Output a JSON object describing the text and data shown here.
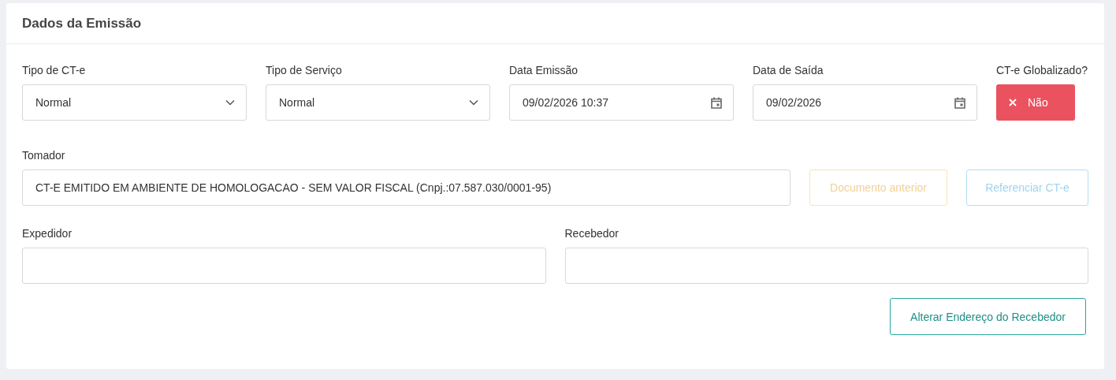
{
  "card": {
    "title": "Dados da Emissão"
  },
  "row_1": [
    {
      "kind": "select",
      "label": "Tipo de CT-e",
      "value": "Normal"
    },
    {
      "kind": "select",
      "label": "Tipo de Serviço",
      "value": "Normal"
    },
    {
      "kind": "date",
      "label": "Data Emissão",
      "value": "09/02/2026 10:37"
    },
    {
      "kind": "date",
      "label": "Data de Saída",
      "value": "09/02/2026"
    }
  ],
  "globalizado": {
    "label": "CT-e Globalizado?",
    "text": "Não",
    "on": false
  },
  "tomador": {
    "label": "Tomador",
    "value": "CT-E EMITIDO EM AMBIENTE DE HOMOLOGACAO - SEM VALOR FISCAL (Cnpj.:07.587.030/0001-95)"
  },
  "tomador_buttons": [
    {
      "kind": "warning",
      "label": "Documento anterior",
      "disabled": true
    },
    {
      "kind": "info",
      "label": "Referenciar CT-e",
      "disabled": true
    }
  ],
  "row_3": [
    {
      "label": "Expedidor"
    },
    {
      "label": "Recebedor"
    }
  ],
  "action_button": {
    "label": "Alterar Endereço do Recebedor"
  }
}
